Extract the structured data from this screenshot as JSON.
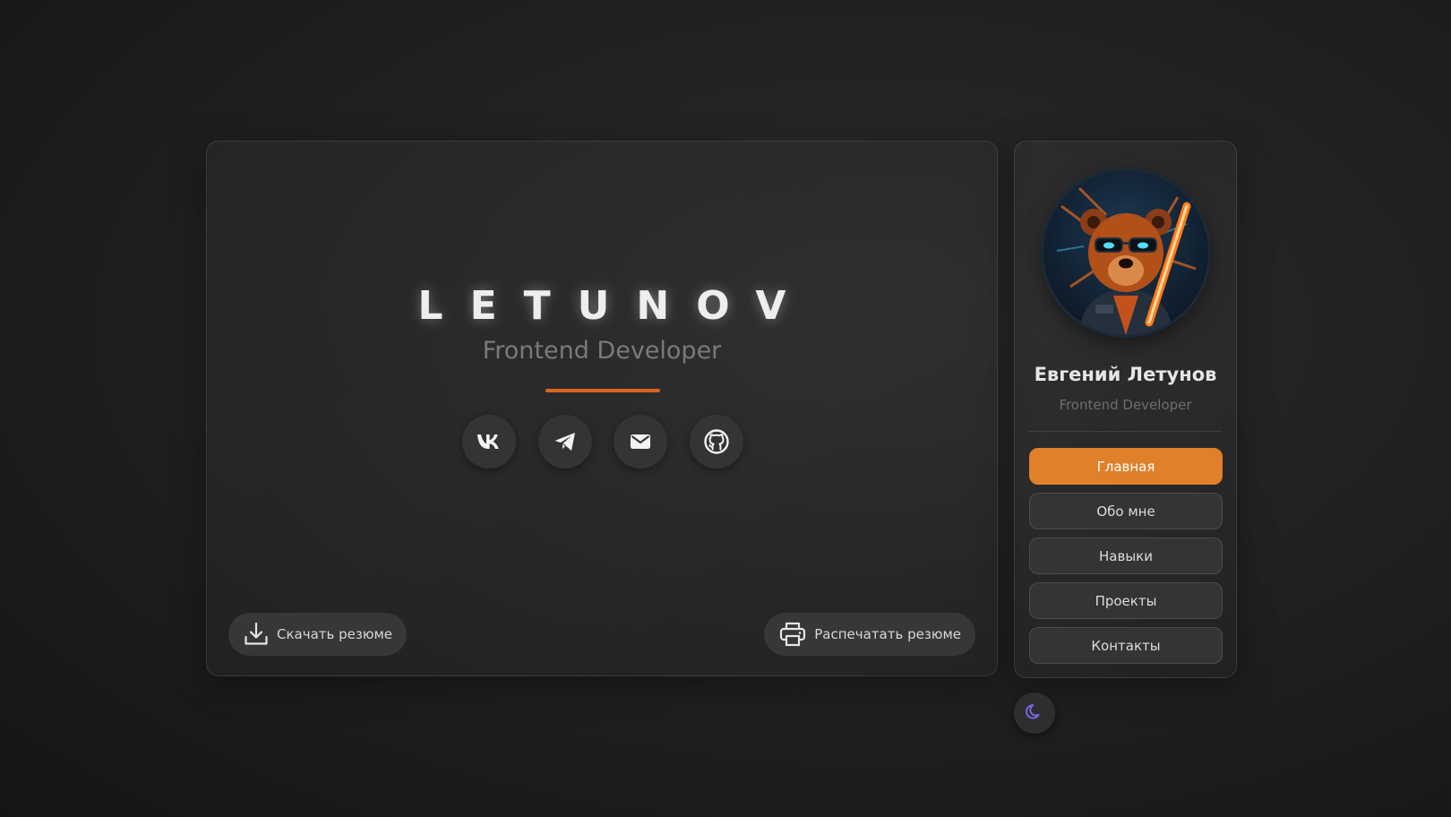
{
  "hero": {
    "name": "LETUNOV",
    "role": "Frontend Developer",
    "accent": "#d9641f",
    "socials": [
      {
        "label": "vk",
        "icon": "vk-icon"
      },
      {
        "label": "telegram",
        "icon": "telegram-icon"
      },
      {
        "label": "email",
        "icon": "mail-icon"
      },
      {
        "label": "github",
        "icon": "github-icon"
      }
    ],
    "download_label": "Скачать резюме",
    "print_label": "Распечатать резюме"
  },
  "sidebar": {
    "name": "Евгений Летунов",
    "role": "Frontend Developer",
    "avatar_icon": "bear-avatar",
    "nav_active_color": "#e0802a",
    "nav": [
      {
        "label": "Главная",
        "active": true
      },
      {
        "label": "Обо мне",
        "active": false
      },
      {
        "label": "Навыки",
        "active": false
      },
      {
        "label": "Проекты",
        "active": false
      },
      {
        "label": "Контакты",
        "active": false
      }
    ]
  },
  "theme_toggle": {
    "icon": "moon-icon",
    "color": "#7b6cf0"
  }
}
